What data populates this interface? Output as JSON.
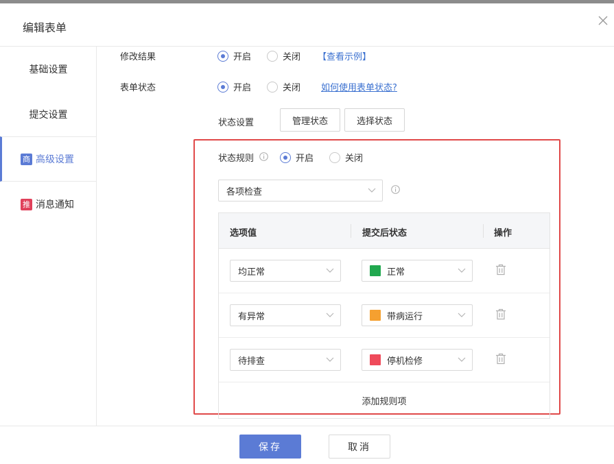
{
  "dialog": {
    "title": "编辑表单"
  },
  "sidebar": {
    "items": [
      {
        "label": "基础设置",
        "badge": ""
      },
      {
        "label": "提交设置",
        "badge": ""
      },
      {
        "label": "高级设置",
        "badge": "商",
        "badge_color": "#5b7bd5"
      },
      {
        "label": "消息通知",
        "badge": "推",
        "badge_color": "#e0405a"
      }
    ]
  },
  "modify_result": {
    "label": "修改结果",
    "on_label": "开启",
    "off_label": "关闭",
    "selected": "开启",
    "link": "【查看示例】"
  },
  "form_status": {
    "label": "表单状态",
    "on_label": "开启",
    "off_label": "关闭",
    "selected": "开启",
    "link": "如何使用表单状态?"
  },
  "status_settings": {
    "label": "状态设置",
    "manage_button": "管理状态",
    "select_button": "选择状态"
  },
  "status_rules": {
    "label": "状态规则",
    "on_label": "开启",
    "off_label": "关闭",
    "selected": "开启",
    "mode_select": "各项检查",
    "columns": [
      "选项值",
      "提交后状态",
      "操作"
    ],
    "rows": [
      {
        "option": "均正常",
        "status": "正常",
        "color": "#21a84f"
      },
      {
        "option": "有异常",
        "status": "带病运行",
        "color": "#f5a030"
      },
      {
        "option": "待排查",
        "status": "停机检修",
        "color": "#ef4a5a"
      }
    ],
    "add_rule": "添加规则项"
  },
  "footer": {
    "save": "保存",
    "cancel": "取消"
  },
  "colors": {
    "accent": "#5b7bd5",
    "highlight_border": "#e04848"
  }
}
